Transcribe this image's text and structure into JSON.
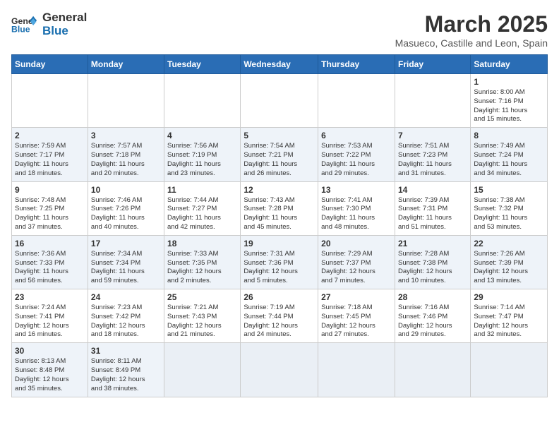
{
  "header": {
    "logo_general": "General",
    "logo_blue": "Blue",
    "month_title": "March 2025",
    "subtitle": "Masueco, Castille and Leon, Spain"
  },
  "weekdays": [
    "Sunday",
    "Monday",
    "Tuesday",
    "Wednesday",
    "Thursday",
    "Friday",
    "Saturday"
  ],
  "weeks": [
    [
      {
        "day": "",
        "info": ""
      },
      {
        "day": "",
        "info": ""
      },
      {
        "day": "",
        "info": ""
      },
      {
        "day": "",
        "info": ""
      },
      {
        "day": "",
        "info": ""
      },
      {
        "day": "",
        "info": ""
      },
      {
        "day": "1",
        "info": "Sunrise: 8:00 AM\nSunset: 7:16 PM\nDaylight: 11 hours\nand 15 minutes."
      }
    ],
    [
      {
        "day": "2",
        "info": "Sunrise: 7:59 AM\nSunset: 7:17 PM\nDaylight: 11 hours\nand 18 minutes."
      },
      {
        "day": "3",
        "info": "Sunrise: 7:57 AM\nSunset: 7:18 PM\nDaylight: 11 hours\nand 20 minutes."
      },
      {
        "day": "4",
        "info": "Sunrise: 7:56 AM\nSunset: 7:19 PM\nDaylight: 11 hours\nand 23 minutes."
      },
      {
        "day": "5",
        "info": "Sunrise: 7:54 AM\nSunset: 7:21 PM\nDaylight: 11 hours\nand 26 minutes."
      },
      {
        "day": "6",
        "info": "Sunrise: 7:53 AM\nSunset: 7:22 PM\nDaylight: 11 hours\nand 29 minutes."
      },
      {
        "day": "7",
        "info": "Sunrise: 7:51 AM\nSunset: 7:23 PM\nDaylight: 11 hours\nand 31 minutes."
      },
      {
        "day": "8",
        "info": "Sunrise: 7:49 AM\nSunset: 7:24 PM\nDaylight: 11 hours\nand 34 minutes."
      }
    ],
    [
      {
        "day": "9",
        "info": "Sunrise: 7:48 AM\nSunset: 7:25 PM\nDaylight: 11 hours\nand 37 minutes."
      },
      {
        "day": "10",
        "info": "Sunrise: 7:46 AM\nSunset: 7:26 PM\nDaylight: 11 hours\nand 40 minutes."
      },
      {
        "day": "11",
        "info": "Sunrise: 7:44 AM\nSunset: 7:27 PM\nDaylight: 11 hours\nand 42 minutes."
      },
      {
        "day": "12",
        "info": "Sunrise: 7:43 AM\nSunset: 7:28 PM\nDaylight: 11 hours\nand 45 minutes."
      },
      {
        "day": "13",
        "info": "Sunrise: 7:41 AM\nSunset: 7:30 PM\nDaylight: 11 hours\nand 48 minutes."
      },
      {
        "day": "14",
        "info": "Sunrise: 7:39 AM\nSunset: 7:31 PM\nDaylight: 11 hours\nand 51 minutes."
      },
      {
        "day": "15",
        "info": "Sunrise: 7:38 AM\nSunset: 7:32 PM\nDaylight: 11 hours\nand 53 minutes."
      }
    ],
    [
      {
        "day": "16",
        "info": "Sunrise: 7:36 AM\nSunset: 7:33 PM\nDaylight: 11 hours\nand 56 minutes."
      },
      {
        "day": "17",
        "info": "Sunrise: 7:34 AM\nSunset: 7:34 PM\nDaylight: 11 hours\nand 59 minutes."
      },
      {
        "day": "18",
        "info": "Sunrise: 7:33 AM\nSunset: 7:35 PM\nDaylight: 12 hours\nand 2 minutes."
      },
      {
        "day": "19",
        "info": "Sunrise: 7:31 AM\nSunset: 7:36 PM\nDaylight: 12 hours\nand 5 minutes."
      },
      {
        "day": "20",
        "info": "Sunrise: 7:29 AM\nSunset: 7:37 PM\nDaylight: 12 hours\nand 7 minutes."
      },
      {
        "day": "21",
        "info": "Sunrise: 7:28 AM\nSunset: 7:38 PM\nDaylight: 12 hours\nand 10 minutes."
      },
      {
        "day": "22",
        "info": "Sunrise: 7:26 AM\nSunset: 7:39 PM\nDaylight: 12 hours\nand 13 minutes."
      }
    ],
    [
      {
        "day": "23",
        "info": "Sunrise: 7:24 AM\nSunset: 7:41 PM\nDaylight: 12 hours\nand 16 minutes."
      },
      {
        "day": "24",
        "info": "Sunrise: 7:23 AM\nSunset: 7:42 PM\nDaylight: 12 hours\nand 18 minutes."
      },
      {
        "day": "25",
        "info": "Sunrise: 7:21 AM\nSunset: 7:43 PM\nDaylight: 12 hours\nand 21 minutes."
      },
      {
        "day": "26",
        "info": "Sunrise: 7:19 AM\nSunset: 7:44 PM\nDaylight: 12 hours\nand 24 minutes."
      },
      {
        "day": "27",
        "info": "Sunrise: 7:18 AM\nSunset: 7:45 PM\nDaylight: 12 hours\nand 27 minutes."
      },
      {
        "day": "28",
        "info": "Sunrise: 7:16 AM\nSunset: 7:46 PM\nDaylight: 12 hours\nand 29 minutes."
      },
      {
        "day": "29",
        "info": "Sunrise: 7:14 AM\nSunset: 7:47 PM\nDaylight: 12 hours\nand 32 minutes."
      }
    ],
    [
      {
        "day": "30",
        "info": "Sunrise: 8:13 AM\nSunset: 8:48 PM\nDaylight: 12 hours\nand 35 minutes."
      },
      {
        "day": "31",
        "info": "Sunrise: 8:11 AM\nSunset: 8:49 PM\nDaylight: 12 hours\nand 38 minutes."
      },
      {
        "day": "",
        "info": ""
      },
      {
        "day": "",
        "info": ""
      },
      {
        "day": "",
        "info": ""
      },
      {
        "day": "",
        "info": ""
      },
      {
        "day": "",
        "info": ""
      }
    ]
  ]
}
